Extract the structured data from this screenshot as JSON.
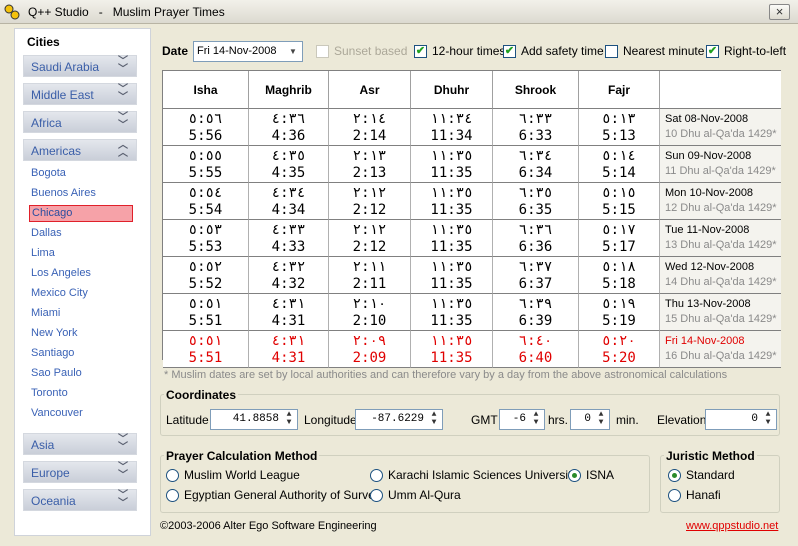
{
  "window": {
    "title": "Q++ Studio   -   Muslim Prayer Times",
    "close": "×"
  },
  "sidebar": {
    "label": "Cities",
    "groups_top": [
      "Saudi Arabia",
      "Middle East",
      "Africa"
    ],
    "open_group": "Americas",
    "cities": [
      "Bogota",
      "Buenos Aires",
      "Chicago",
      "Dallas",
      "Lima",
      "Los Angeles",
      "Mexico City",
      "Miami",
      "New York",
      "Santiago",
      "Sao Paulo",
      "Toronto",
      "Vancouver"
    ],
    "selected_city": "Chicago",
    "groups_bottom": [
      "Asia",
      "Europe",
      "Oceania"
    ]
  },
  "controls": {
    "date_label": "Date",
    "date_value": "Fri 14-Nov-2008",
    "options": [
      {
        "label": "Sunset based",
        "checked": false,
        "disabled": true
      },
      {
        "label": "12-hour times",
        "checked": true,
        "disabled": false
      },
      {
        "label": "Add safety time",
        "checked": true,
        "disabled": false
      },
      {
        "label": "Nearest minute",
        "checked": false,
        "disabled": false
      },
      {
        "label": "Right-to-left",
        "checked": true,
        "disabled": false
      }
    ]
  },
  "table": {
    "headers": [
      "Isha",
      "Maghrib",
      "Asr",
      "Dhuhr",
      "Shrook",
      "Fajr"
    ],
    "rows": [
      {
        "times": [
          [
            "٥:٥٦",
            "5:56"
          ],
          [
            "٤:٣٦",
            "4:36"
          ],
          [
            "٢:١٤",
            "2:14"
          ],
          [
            "١١:٣٤",
            "11:34"
          ],
          [
            "٦:٣٣",
            "6:33"
          ],
          [
            "٥:١٣",
            "5:13"
          ]
        ],
        "gregorian": "Sat 08-Nov-2008",
        "hijri": "10 Dhu al-Qa'da 1429*",
        "today": false
      },
      {
        "times": [
          [
            "٥:٥٥",
            "5:55"
          ],
          [
            "٤:٣٥",
            "4:35"
          ],
          [
            "٢:١٣",
            "2:13"
          ],
          [
            "١١:٣٥",
            "11:35"
          ],
          [
            "٦:٣٤",
            "6:34"
          ],
          [
            "٥:١٤",
            "5:14"
          ]
        ],
        "gregorian": "Sun 09-Nov-2008",
        "hijri": "11 Dhu al-Qa'da 1429*",
        "today": false
      },
      {
        "times": [
          [
            "٥:٥٤",
            "5:54"
          ],
          [
            "٤:٣٤",
            "4:34"
          ],
          [
            "٢:١٢",
            "2:12"
          ],
          [
            "١١:٣٥",
            "11:35"
          ],
          [
            "٦:٣٥",
            "6:35"
          ],
          [
            "٥:١٥",
            "5:15"
          ]
        ],
        "gregorian": "Mon 10-Nov-2008",
        "hijri": "12 Dhu al-Qa'da 1429*",
        "today": false
      },
      {
        "times": [
          [
            "٥:٥٣",
            "5:53"
          ],
          [
            "٤:٣٣",
            "4:33"
          ],
          [
            "٢:١٢",
            "2:12"
          ],
          [
            "١١:٣٥",
            "11:35"
          ],
          [
            "٦:٣٦",
            "6:36"
          ],
          [
            "٥:١٧",
            "5:17"
          ]
        ],
        "gregorian": "Tue 11-Nov-2008",
        "hijri": "13 Dhu al-Qa'da 1429*",
        "today": false
      },
      {
        "times": [
          [
            "٥:٥٢",
            "5:52"
          ],
          [
            "٤:٣٢",
            "4:32"
          ],
          [
            "٢:١١",
            "2:11"
          ],
          [
            "١١:٣٥",
            "11:35"
          ],
          [
            "٦:٣٧",
            "6:37"
          ],
          [
            "٥:١٨",
            "5:18"
          ]
        ],
        "gregorian": "Wed 12-Nov-2008",
        "hijri": "14 Dhu al-Qa'da 1429*",
        "today": false
      },
      {
        "times": [
          [
            "٥:٥١",
            "5:51"
          ],
          [
            "٤:٣١",
            "4:31"
          ],
          [
            "٢:١٠",
            "2:10"
          ],
          [
            "١١:٣٥",
            "11:35"
          ],
          [
            "٦:٣٩",
            "6:39"
          ],
          [
            "٥:١٩",
            "5:19"
          ]
        ],
        "gregorian": "Thu 13-Nov-2008",
        "hijri": "15 Dhu al-Qa'da 1429*",
        "today": false
      },
      {
        "times": [
          [
            "٥:٥١",
            "5:51"
          ],
          [
            "٤:٣١",
            "4:31"
          ],
          [
            "٢:٠٩",
            "2:09"
          ],
          [
            "١١:٣٥",
            "11:35"
          ],
          [
            "٦:٤٠",
            "6:40"
          ],
          [
            "٥:٢٠",
            "5:20"
          ]
        ],
        "gregorian": "Fri 14-Nov-2008",
        "hijri": "16 Dhu al-Qa'da 1429*",
        "today": true
      }
    ],
    "note": "* Muslim dates are set by local authorities and can therefore vary by a day from the above astronomical calculations"
  },
  "coordinates": {
    "title": "Coordinates",
    "latitude_label": "Latitude",
    "latitude": "41.8858",
    "longitude_label": "Longitude",
    "longitude": "-87.6229",
    "gmt_label": "GMT",
    "gmt": "-6",
    "hrs_label": "hrs.",
    "min": "0",
    "min_label": "min.",
    "elevation_label": "Elevation",
    "elevation": "0"
  },
  "calculation": {
    "title": "Prayer Calculation Method",
    "options": [
      {
        "label": "Muslim World League",
        "selected": false
      },
      {
        "label": "Karachi Islamic Sciences University",
        "selected": false
      },
      {
        "label": "ISNA",
        "selected": true
      },
      {
        "label": "Egyptian General Authority of Survey",
        "selected": false
      },
      {
        "label": "Umm Al-Qura",
        "selected": false
      }
    ]
  },
  "juristic": {
    "title": "Juristic Method",
    "options": [
      {
        "label": "Standard",
        "selected": true
      },
      {
        "label": "Hanafi",
        "selected": false
      }
    ]
  },
  "footer": {
    "copyright": "©2003-2006 Alter Ego Software Engineering",
    "link": "www.qppstudio.net"
  }
}
